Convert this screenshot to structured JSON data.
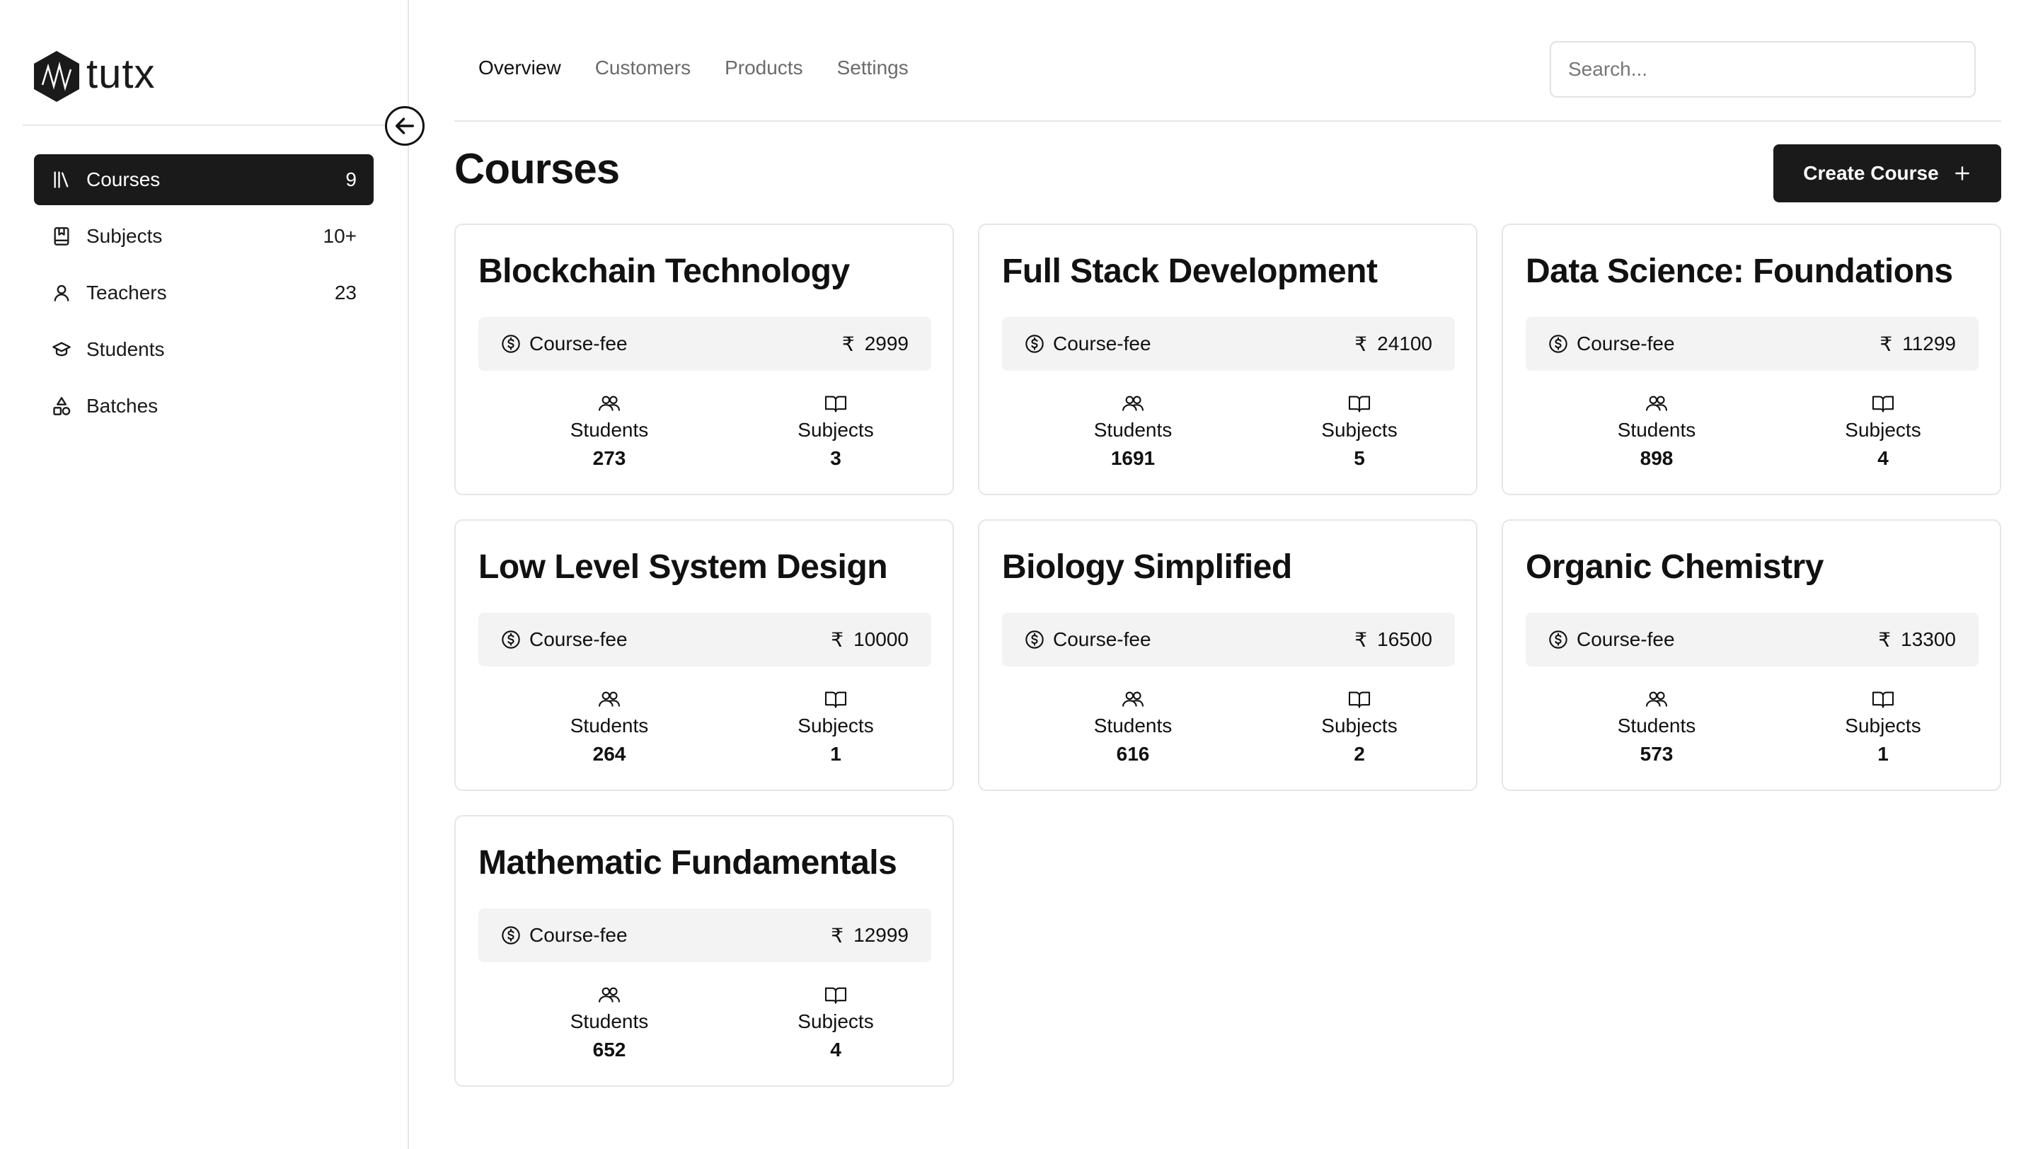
{
  "brand": {
    "name": "tutx"
  },
  "sidebar": {
    "items": [
      {
        "label": "Courses",
        "count": "9",
        "icon": "library-icon"
      },
      {
        "label": "Subjects",
        "count": "10+",
        "icon": "book-bookmark-icon"
      },
      {
        "label": "Teachers",
        "count": "23",
        "icon": "user-icon"
      },
      {
        "label": "Students",
        "count": "",
        "icon": "graduation-cap-icon"
      },
      {
        "label": "Batches",
        "count": "",
        "icon": "shapes-icon"
      }
    ]
  },
  "header": {
    "tabs": [
      "Overview",
      "Customers",
      "Products",
      "Settings"
    ],
    "active_tab": "Overview",
    "search_placeholder": "Search..."
  },
  "main": {
    "title": "Courses",
    "create_label": "Create Course",
    "fee_label": "Course-fee",
    "rupee": "₹",
    "students_label": "Students",
    "subjects_label": "Subjects",
    "courses": [
      {
        "title": "Blockchain Technology",
        "fee": "2999",
        "students": "273",
        "subjects": "3"
      },
      {
        "title": "Full Stack Development",
        "fee": "24100",
        "students": "1691",
        "subjects": "5"
      },
      {
        "title": "Data Science: Foundations",
        "fee": "11299",
        "students": "898",
        "subjects": "4"
      },
      {
        "title": "Low Level System Design",
        "fee": "10000",
        "students": "264",
        "subjects": "1"
      },
      {
        "title": "Biology Simplified",
        "fee": "16500",
        "students": "616",
        "subjects": "2"
      },
      {
        "title": "Organic Chemistry",
        "fee": "13300",
        "students": "573",
        "subjects": "1"
      },
      {
        "title": "Mathematic Fundamentals",
        "fee": "12999",
        "students": "652",
        "subjects": "4"
      }
    ]
  },
  "colors": {
    "accent": "#1a1a1a",
    "fee_bg": "#f3f3f3",
    "border": "#e6e6e6"
  }
}
